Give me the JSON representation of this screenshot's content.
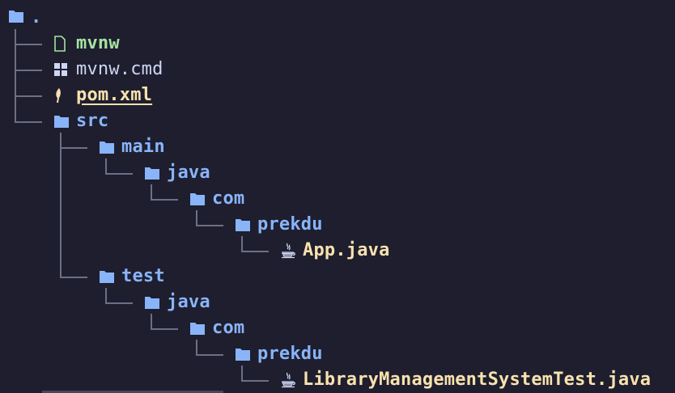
{
  "tree": {
    "root": {
      "label": ".",
      "icon": "folder-icon"
    },
    "items": [
      {
        "label": "mvnw",
        "icon": "file-icon",
        "kind": "exe",
        "depth": 1
      },
      {
        "label": "mvnw.cmd",
        "icon": "windows-icon",
        "kind": "cmd",
        "depth": 1
      },
      {
        "label": "pom.xml",
        "icon": "maven-icon",
        "kind": "build",
        "depth": 1
      },
      {
        "label": "src",
        "icon": "folder-icon",
        "kind": "dir",
        "depth": 1
      },
      {
        "label": "main",
        "icon": "folder-icon",
        "kind": "dir",
        "depth": 2
      },
      {
        "label": "java",
        "icon": "folder-icon",
        "kind": "dir",
        "depth": 3
      },
      {
        "label": "com",
        "icon": "folder-icon",
        "kind": "dir",
        "depth": 4
      },
      {
        "label": "prekdu",
        "icon": "folder-icon",
        "kind": "dir",
        "depth": 5
      },
      {
        "label": "App.java",
        "icon": "java-icon",
        "kind": "java",
        "depth": 6
      },
      {
        "label": "test",
        "icon": "folder-icon",
        "kind": "dir",
        "depth": 2
      },
      {
        "label": "java",
        "icon": "folder-icon",
        "kind": "dir",
        "depth": 3
      },
      {
        "label": "com",
        "icon": "folder-icon",
        "kind": "dir",
        "depth": 4
      },
      {
        "label": "prekdu",
        "icon": "folder-icon",
        "kind": "dir",
        "depth": 5
      },
      {
        "label": "LibraryManagementSystemTest.java",
        "icon": "java-icon",
        "kind": "java",
        "depth": 6
      }
    ]
  },
  "colors": {
    "background": "#1e1e2e",
    "folder": "#89b4fa",
    "executable": "#a6e3a1",
    "plain": "#cdd6f4",
    "java_file": "#f9e2af",
    "tree_lines": "#6c7086"
  }
}
